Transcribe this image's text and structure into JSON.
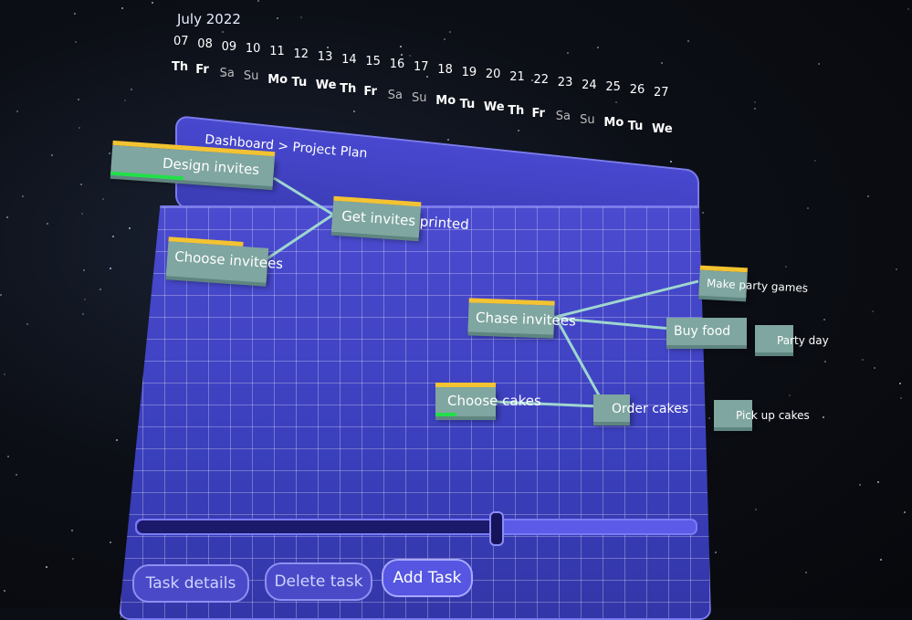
{
  "calendar": {
    "month_label": "July 2022",
    "days": [
      {
        "date": "07",
        "dow": "Th"
      },
      {
        "date": "08",
        "dow": "Fr"
      },
      {
        "date": "09",
        "dow": "Sa"
      },
      {
        "date": "10",
        "dow": "Su"
      },
      {
        "date": "11",
        "dow": "Mo"
      },
      {
        "date": "12",
        "dow": "Tu"
      },
      {
        "date": "13",
        "dow": "We"
      },
      {
        "date": "14",
        "dow": "Th"
      },
      {
        "date": "15",
        "dow": "Fr"
      },
      {
        "date": "16",
        "dow": "Sa"
      },
      {
        "date": "17",
        "dow": "Su"
      },
      {
        "date": "18",
        "dow": "Mo"
      },
      {
        "date": "19",
        "dow": "Tu"
      },
      {
        "date": "20",
        "dow": "We"
      },
      {
        "date": "21",
        "dow": "Th"
      },
      {
        "date": "22",
        "dow": "Fr"
      },
      {
        "date": "23",
        "dow": "Sa"
      },
      {
        "date": "24",
        "dow": "Su"
      },
      {
        "date": "25",
        "dow": "Mo"
      },
      {
        "date": "26",
        "dow": "Tu"
      },
      {
        "date": "27",
        "dow": "We"
      }
    ]
  },
  "breadcrumb": "Dashboard > Project Plan",
  "tasks": {
    "design_invites": "Design invites",
    "get_invites_printed": "Get invites printed",
    "choose_invitees": "Choose invitees",
    "chase_invitees": "Chase invitees",
    "make_party_games": "Make party games",
    "buy_food": "Buy food",
    "party_day": "Party day",
    "choose_cakes": "Choose cakes",
    "order_cakes": "Order cakes",
    "pick_up_cakes": "Pick up cakes"
  },
  "progress": {
    "design_invites": 0.45,
    "choose_cakes": 0.35
  },
  "timeline_slider": {
    "position": 0.64
  },
  "buttons": {
    "task_details": "Task details",
    "delete_task": "Delete task",
    "add_task": "Add Task"
  },
  "colors": {
    "panel": "#4b4bd0",
    "task_block": "#7fa6a0",
    "task_topbar": "#f3c331",
    "progress_bar": "#22e04a",
    "dependency_line": "#9fd6cf"
  }
}
